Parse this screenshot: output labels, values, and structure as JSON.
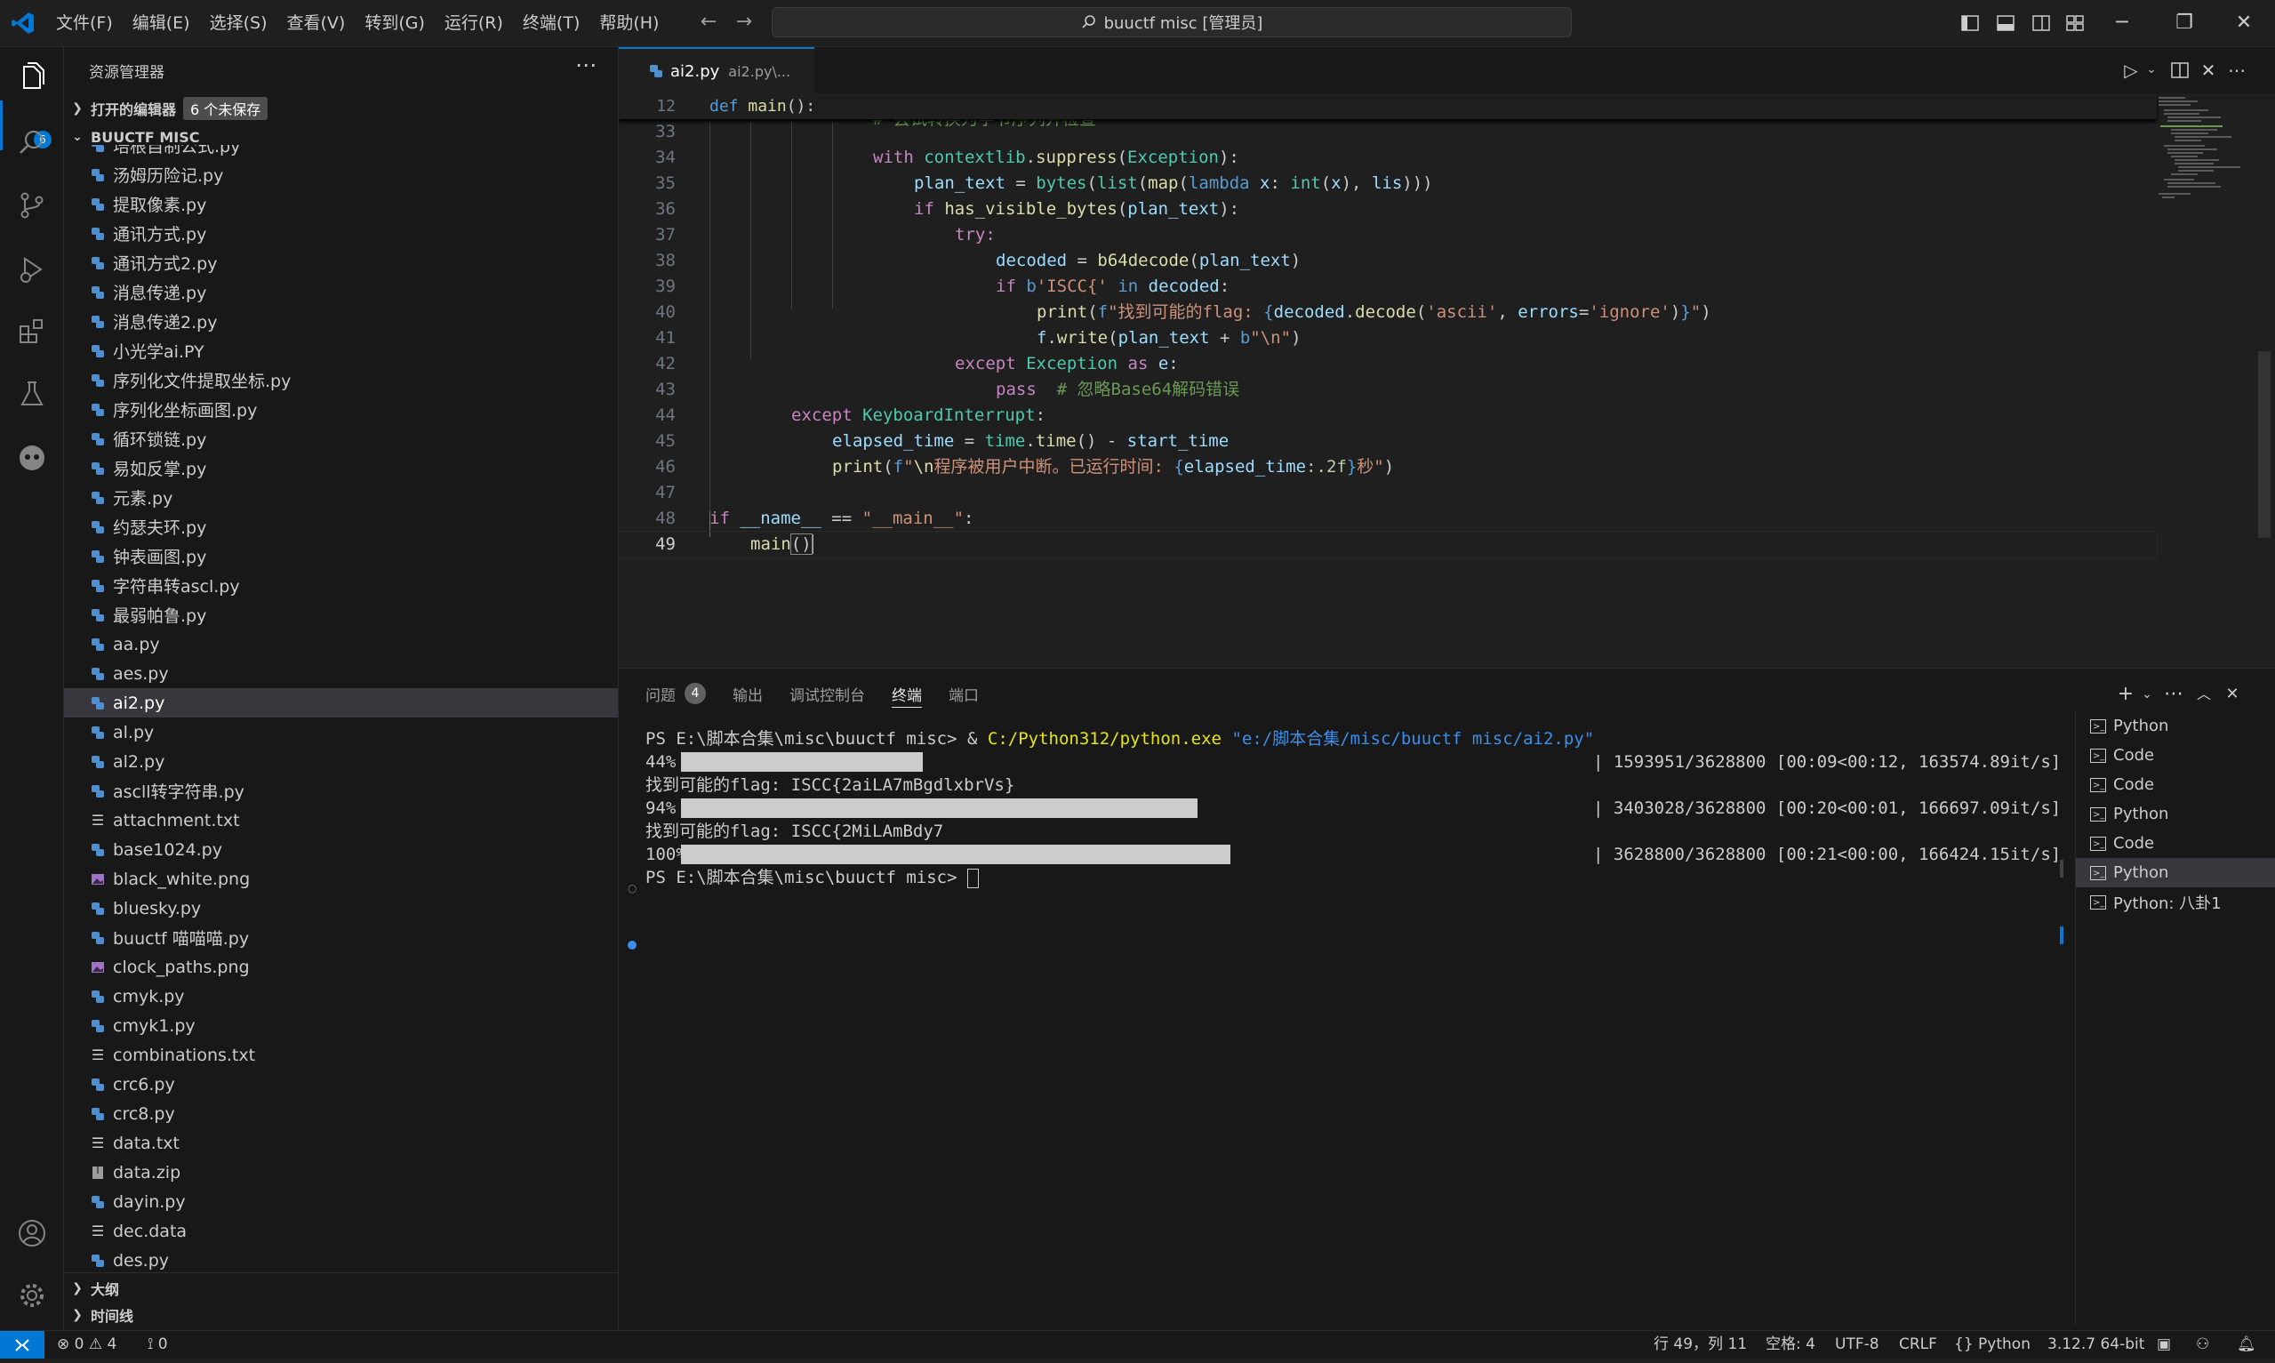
{
  "menu": [
    "文件(F)",
    "编辑(E)",
    "选择(S)",
    "查看(V)",
    "转到(G)",
    "运行(R)",
    "终端(T)",
    "帮助(H)"
  ],
  "search": {
    "text": "buuctf misc [管理员]"
  },
  "activity": {
    "explorer_badge": "6"
  },
  "sidebar": {
    "title": "资源管理器",
    "open_editors": "打开的编辑器",
    "unsaved": "6 个未保存",
    "folder": "BUUCTF MISC",
    "outline": "大纲",
    "timeline": "时间线"
  },
  "files": [
    {
      "name": "培根自制公式.py",
      "icon": "python"
    },
    {
      "name": "汤姆历险记.py",
      "icon": "python"
    },
    {
      "name": "提取像素.py",
      "icon": "python"
    },
    {
      "name": "通讯方式.py",
      "icon": "python"
    },
    {
      "name": "通讯方式2.py",
      "icon": "python"
    },
    {
      "name": "消息传递.py",
      "icon": "python"
    },
    {
      "name": "消息传递2.py",
      "icon": "python"
    },
    {
      "name": "小光学ai.PY",
      "icon": "python"
    },
    {
      "name": "序列化文件提取坐标.py",
      "icon": "python"
    },
    {
      "name": "序列化坐标画图.py",
      "icon": "python"
    },
    {
      "name": "循环锁链.py",
      "icon": "python"
    },
    {
      "name": "易如反掌.py",
      "icon": "python"
    },
    {
      "name": "元素.py",
      "icon": "python"
    },
    {
      "name": "约瑟夫环.py",
      "icon": "python"
    },
    {
      "name": "钟表画图.py",
      "icon": "python"
    },
    {
      "name": "字符串转ascl.py",
      "icon": "python"
    },
    {
      "name": "最弱帕鲁.py",
      "icon": "python"
    },
    {
      "name": "aa.py",
      "icon": "python"
    },
    {
      "name": "aes.py",
      "icon": "python"
    },
    {
      "name": "ai2.py",
      "icon": "python",
      "selected": true
    },
    {
      "name": "al.py",
      "icon": "python"
    },
    {
      "name": "al2.py",
      "icon": "python"
    },
    {
      "name": "ascll转字符串.py",
      "icon": "python"
    },
    {
      "name": "attachment.txt",
      "icon": "text"
    },
    {
      "name": "base1024.py",
      "icon": "python"
    },
    {
      "name": "black_white.png",
      "icon": "image"
    },
    {
      "name": "bluesky.py",
      "icon": "python"
    },
    {
      "name": "buuctf 喵喵喵.py",
      "icon": "python"
    },
    {
      "name": "clock_paths.png",
      "icon": "image"
    },
    {
      "name": "cmyk.py",
      "icon": "python"
    },
    {
      "name": "cmyk1.py",
      "icon": "python"
    },
    {
      "name": "combinations.txt",
      "icon": "text"
    },
    {
      "name": "crc6.py",
      "icon": "python"
    },
    {
      "name": "crc8.py",
      "icon": "python"
    },
    {
      "name": "data.txt",
      "icon": "text"
    },
    {
      "name": "data.zip",
      "icon": "zip"
    },
    {
      "name": "dayin.py",
      "icon": "python"
    },
    {
      "name": "dec.data",
      "icon": "text"
    },
    {
      "name": "des.py",
      "icon": "python"
    }
  ],
  "editor": {
    "tab_name": "ai2.py",
    "tab_path": "ai2.py\\...",
    "sticky": {
      "num": "12",
      "code": "def main():"
    },
    "lines": [
      {
        "num": "33",
        "code": "# 尝试转换为字节序列并检查"
      },
      {
        "num": "34",
        "code": "with contextlib.suppress(Exception):"
      },
      {
        "num": "35",
        "code": "plan_text = bytes(list(map(lambda x: int(x), lis)))"
      },
      {
        "num": "36",
        "code": "if has_visible_bytes(plan_text):"
      },
      {
        "num": "37",
        "code": "try:"
      },
      {
        "num": "38",
        "code": "decoded = b64decode(plan_text)"
      },
      {
        "num": "39",
        "code": "if b'ISCC{' in decoded:"
      },
      {
        "num": "40",
        "code": "print(f\"找到可能的flag: {decoded.decode('ascii', errors='ignore')}\")"
      },
      {
        "num": "41",
        "code": "f.write(plan_text + b\"\\n\")"
      },
      {
        "num": "42",
        "code": "except Exception as e:"
      },
      {
        "num": "43",
        "code": "pass  # 忽略Base64解码错误"
      },
      {
        "num": "44",
        "code": "except KeyboardInterrupt:"
      },
      {
        "num": "45",
        "code": "elapsed_time = time.time() - start_time"
      },
      {
        "num": "46",
        "code": "print(f\"\\n程序被用户中断。已运行时间: {elapsed_time:.2f}秒\")"
      },
      {
        "num": "47",
        "code": ""
      },
      {
        "num": "48",
        "code": "if __name__ == \"__main__\":"
      },
      {
        "num": "49",
        "code": "main()"
      }
    ]
  },
  "panel": {
    "tabs": [
      "问题",
      "输出",
      "调试控制台",
      "终端",
      "端口"
    ],
    "problems_count": "4",
    "active_tab": "终端",
    "terminal": {
      "cmd_prompt": "PS E:\\脚本合集\\misc\\buuctf misc> ",
      "cmd_amp": "& ",
      "cmd_exe": "C:/Python312/python.exe",
      "cmd_arg": "\"e:/脚本合集/misc/buuctf misc/ai2.py\"",
      "progress": [
        {
          "pct": "44%",
          "fraction": 0.44,
          "stats": "| 1593951/3628800 [00:09<00:12, 163574.89it/s]"
        },
        {
          "pct": "94%",
          "fraction": 0.94,
          "stats": "| 3403028/3628800 [00:20<00:01, 166697.09it/s]"
        },
        {
          "pct": "100%",
          "fraction": 1.0,
          "stats": "| 3628800/3628800 [00:21<00:00, 166424.15it/s]"
        }
      ],
      "found1": "找到可能的flag: ISCC{2aiLA7mBgdlxbrVs}",
      "found2": "找到可能的flag: ISCC{2MiLAmBdy7",
      "final_prompt": "PS E:\\脚本合集\\misc\\buuctf misc> "
    },
    "terminals": [
      {
        "name": "Python"
      },
      {
        "name": "Code"
      },
      {
        "name": "Code"
      },
      {
        "name": "Python"
      },
      {
        "name": "Code"
      },
      {
        "name": "Python",
        "selected": true
      },
      {
        "name": "Python: 八卦1"
      }
    ]
  },
  "status": {
    "errors": "0",
    "warnings": "4",
    "ports": "0",
    "position": "行 49，列 11",
    "spaces": "空格: 4",
    "encoding": "UTF-8",
    "eol": "CRLF",
    "language": "Python",
    "interpreter": "3.12.7 64-bit"
  },
  "colors": {
    "accent": "#0078d4",
    "python_icon": "#4f8fd0",
    "image_icon": "#a074c4"
  }
}
